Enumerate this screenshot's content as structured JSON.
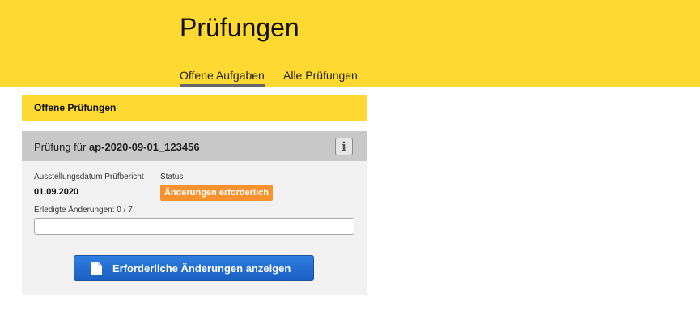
{
  "header": {
    "title": "Prüfungen",
    "tabs": [
      {
        "label": "Offene Aufgaben",
        "active": true
      },
      {
        "label": "Alle Prüfungen",
        "active": false
      }
    ]
  },
  "section": {
    "title": "Offene Prüfungen"
  },
  "card": {
    "title_prefix": "Prüfung für",
    "title_id": "ap-2020-09-01_123456",
    "info_icon": "info-icon",
    "date_label": "Ausstellungsdatum Prüfbericht",
    "date_value": "01.09.2020",
    "status_label": "Status",
    "status_value": "Änderungen erforderlich",
    "progress_label": "Erledigte Änderungen: 0 / 7",
    "progress_done": 0,
    "progress_total": 7,
    "button_label": "Erforderliche Änderungen anzeigen",
    "button_icon": "document-icon"
  },
  "colors": {
    "brand_yellow": "#fed931",
    "status_orange": "#f7922e",
    "button_blue": "#1f6bd0",
    "card_header_gray": "#c8c8c8",
    "card_body_gray": "#f1f1f1"
  }
}
